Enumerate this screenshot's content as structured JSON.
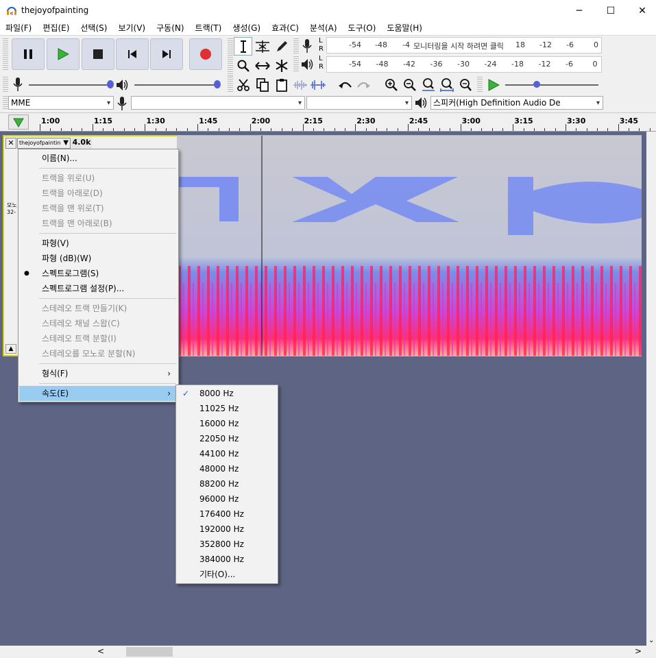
{
  "window": {
    "title": "thejoyofpainting",
    "minimize_glyph": "─",
    "maximize_glyph": "☐",
    "close_glyph": "✕"
  },
  "menubar": [
    "파일(F)",
    "편집(E)",
    "선택(S)",
    "보기(V)",
    "구동(N)",
    "트랙(T)",
    "생성(G)",
    "효과(C)",
    "분석(A)",
    "도구(O)",
    "도움말(H)"
  ],
  "meters": {
    "record_ticks": [
      "-54",
      "-48",
      "-4",
      "18",
      "-12",
      "-6",
      "0"
    ],
    "record_hint": "모니터링을 시작 하려면 클릭",
    "play_ticks": [
      "-54",
      "-48",
      "-42",
      "-36",
      "-30",
      "-24",
      "-18",
      "-12",
      "-6",
      "0"
    ],
    "l": "L",
    "r": "R"
  },
  "device": {
    "host": "MME",
    "recording_device": "",
    "channels": "",
    "playback_device": "스피커(High Definition Audio De"
  },
  "timeline": [
    "1:00",
    "1:15",
    "1:30",
    "1:45",
    "2:00",
    "2:15",
    "2:30",
    "2:45",
    "3:00",
    "3:15",
    "3:30",
    "3:45"
  ],
  "track": {
    "name": "thejoyofpaintin",
    "rate_label": "4.0k",
    "close_glyph": "✕",
    "format_text": "모노",
    "bits_text": "32-"
  },
  "context_menu": {
    "items": [
      {
        "label": "이름(N)...",
        "disabled": false
      },
      {
        "label": "트랙을 위로(U)",
        "disabled": true
      },
      {
        "label": "트랙을 아래로(D)",
        "disabled": true
      },
      {
        "label": "트랙을 맨 위로(T)",
        "disabled": true
      },
      {
        "label": "트랙을 맨 아래로(B)",
        "disabled": true
      },
      {
        "label": "파형(V)",
        "disabled": false
      },
      {
        "label": "파형 (dB)(W)",
        "disabled": false
      },
      {
        "label": "스펙트로그램(S)",
        "disabled": false,
        "selected": true
      },
      {
        "label": "스펙트로그램 설정(P)...",
        "disabled": false
      },
      {
        "label": "스테레오 트랙 만들기(K)",
        "disabled": true
      },
      {
        "label": "스테레오 채널 스왑(C)",
        "disabled": true
      },
      {
        "label": "스테레오 트랙 분할(I)",
        "disabled": true
      },
      {
        "label": "스테레오를 모노로 분할(N)",
        "disabled": true
      },
      {
        "label": "형식(F)",
        "disabled": false,
        "submenu": true
      },
      {
        "label": "속도(E)",
        "disabled": false,
        "submenu": true,
        "highlighted": true
      }
    ],
    "bullet": "●",
    "submenu_glyph": "›"
  },
  "rate_submenu": {
    "items": [
      "8000 Hz",
      "11025 Hz",
      "16000 Hz",
      "22050 Hz",
      "44100 Hz",
      "48000 Hz",
      "88200 Hz",
      "96000 Hz",
      "176400 Hz",
      "192000 Hz",
      "352800 Hz",
      "384000 Hz",
      "기타(O)..."
    ],
    "checked_index": 0,
    "check_glyph": "✓"
  },
  "scroll": {
    "left": "<",
    "right": ">",
    "down": "⌄"
  },
  "colors": {
    "accent_highlight": "#99ccf0",
    "track_bg": "#5e6483",
    "selection_border": "#d8d000",
    "record_red": "#e03030",
    "play_green": "#3bb33b"
  }
}
